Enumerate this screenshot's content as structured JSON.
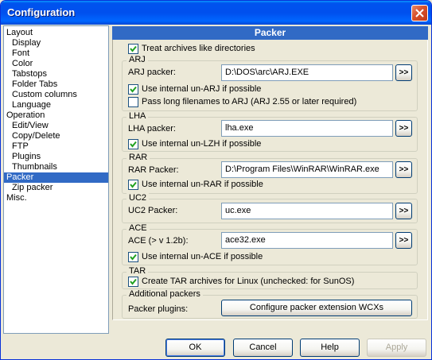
{
  "window": {
    "title": "Configuration"
  },
  "tree": {
    "items": [
      {
        "label": "Layout",
        "indent": 0
      },
      {
        "label": "Display",
        "indent": 1
      },
      {
        "label": "Font",
        "indent": 1
      },
      {
        "label": "Color",
        "indent": 1
      },
      {
        "label": "Tabstops",
        "indent": 1
      },
      {
        "label": "Folder Tabs",
        "indent": 1
      },
      {
        "label": "Custom columns",
        "indent": 1
      },
      {
        "label": "Language",
        "indent": 1
      },
      {
        "label": "Operation",
        "indent": 0
      },
      {
        "label": "Edit/View",
        "indent": 1
      },
      {
        "label": "Copy/Delete",
        "indent": 1
      },
      {
        "label": "FTP",
        "indent": 1
      },
      {
        "label": "Plugins",
        "indent": 1
      },
      {
        "label": "Thumbnails",
        "indent": 1
      },
      {
        "label": "Packer",
        "indent": 0,
        "selected": true
      },
      {
        "label": "Zip packer",
        "indent": 1
      },
      {
        "label": "Misc.",
        "indent": 0
      }
    ]
  },
  "panel": {
    "title": "Packer",
    "treat_archives": {
      "label": "Treat archives like directories",
      "checked": true
    },
    "arj": {
      "legend": "ARJ",
      "packer_label": "ARJ packer:",
      "packer_value": "D:\\DOS\\arc\\ARJ.EXE",
      "use_internal": {
        "label": "Use internal un-ARJ if possible",
        "checked": true
      },
      "long_names": {
        "label": "Pass long filenames to ARJ (ARJ 2.55 or later required)",
        "checked": false
      }
    },
    "lha": {
      "legend": "LHA",
      "packer_label": "LHA packer:",
      "packer_value": "lha.exe",
      "use_internal": {
        "label": "Use internal un-LZH if possible",
        "checked": true
      }
    },
    "rar": {
      "legend": "RAR",
      "packer_label": "RAR Packer:",
      "packer_value": "D:\\Program Files\\WinRAR\\WinRAR.exe",
      "use_internal": {
        "label": "Use internal un-RAR if possible",
        "checked": true
      }
    },
    "uc2": {
      "legend": "UC2",
      "packer_label": "UC2 Packer:",
      "packer_value": "uc.exe"
    },
    "ace": {
      "legend": "ACE",
      "packer_label": "ACE (> v 1.2b):",
      "packer_value": "ace32.exe",
      "use_internal": {
        "label": "Use internal un-ACE if possible",
        "checked": true
      }
    },
    "tar": {
      "legend": "TAR",
      "create_tar": {
        "label": "Create TAR archives for Linux (unchecked: for SunOS)",
        "checked": true
      }
    },
    "additional": {
      "legend": "Additional packers",
      "plugins_label": "Packer plugins:",
      "configure_label": "Configure packer extension WCXs"
    },
    "browse_label": ">>"
  },
  "buttons": {
    "ok": "OK",
    "cancel": "Cancel",
    "help": "Help",
    "apply": "Apply"
  },
  "colors": {
    "selection": "#316ac5",
    "titlebar": "#0053ee",
    "face": "#ece9d8"
  }
}
